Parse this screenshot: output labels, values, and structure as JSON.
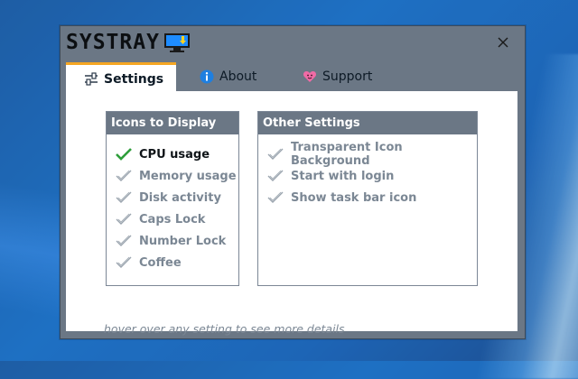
{
  "window": {
    "title": "SYSTRAY",
    "close_label": "✕"
  },
  "tabs": [
    {
      "label": "Settings",
      "icon": "sliders-icon",
      "active": true
    },
    {
      "label": "About",
      "icon": "info-icon",
      "active": false
    },
    {
      "label": "Support",
      "icon": "heart-icon",
      "active": false
    }
  ],
  "icons_panel": {
    "title": "Icons to Display",
    "items": [
      {
        "label": "CPU usage",
        "checked": true
      },
      {
        "label": "Memory usage",
        "checked": false
      },
      {
        "label": "Disk activity",
        "checked": false
      },
      {
        "label": "Caps Lock",
        "checked": false
      },
      {
        "label": "Number Lock",
        "checked": false
      },
      {
        "label": "Coffee",
        "checked": false
      }
    ]
  },
  "other_panel": {
    "title": "Other Settings",
    "items": [
      {
        "label": "Transparent Icon Background",
        "checked": false
      },
      {
        "label": "Start with login",
        "checked": false
      },
      {
        "label": "Show task bar icon",
        "checked": false
      }
    ]
  },
  "hint": "hover over any setting to see more details",
  "colors": {
    "accent_tab": "#f5a623",
    "check_on": "#2e9e3a",
    "check_off": "#9aa4ae",
    "header_bg": "#6b7785"
  }
}
